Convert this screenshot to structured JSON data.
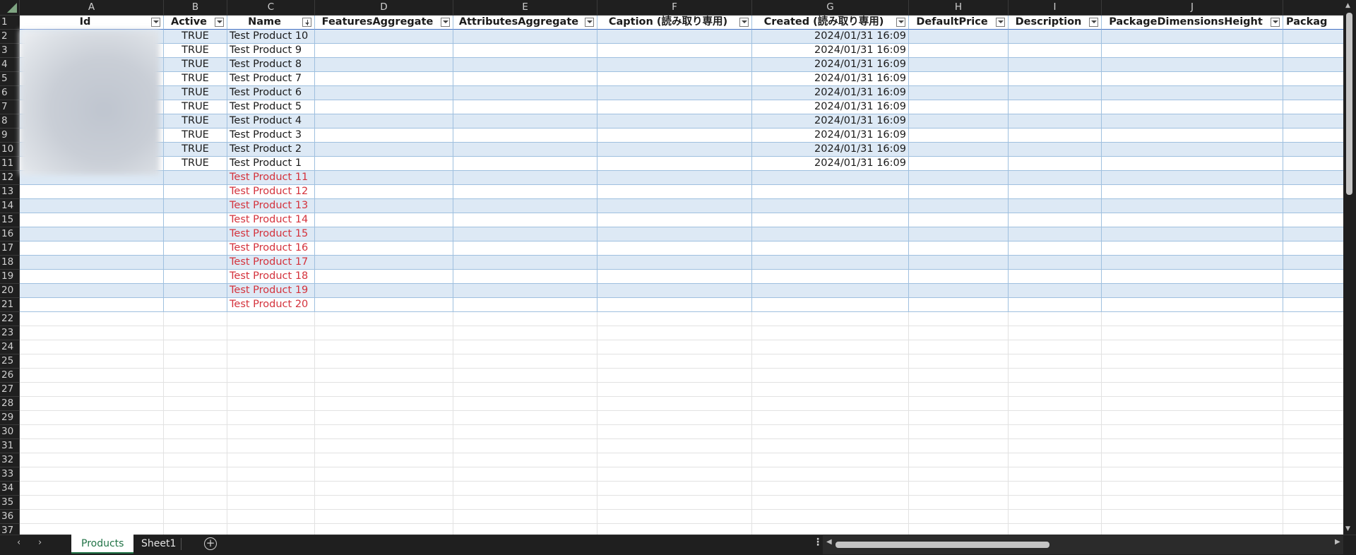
{
  "columns": [
    {
      "letter": "A",
      "header": "Id",
      "width": 204,
      "align": "left"
    },
    {
      "letter": "B",
      "header": "Active",
      "width": 90,
      "align": "center"
    },
    {
      "letter": "C",
      "header": "Name",
      "width": 124,
      "align": "left",
      "sorted": true
    },
    {
      "letter": "D",
      "header": "FeaturesAggregate",
      "width": 196,
      "align": "left"
    },
    {
      "letter": "E",
      "header": "AttributesAggregate",
      "width": 204,
      "align": "left"
    },
    {
      "letter": "F",
      "header": "Caption (読み取り専用)",
      "width": 219,
      "align": "left"
    },
    {
      "letter": "G",
      "header": "Created (読み取り専用)",
      "width": 222,
      "align": "right"
    },
    {
      "letter": "H",
      "header": "DefaultPrice",
      "width": 141,
      "align": "left"
    },
    {
      "letter": "I",
      "header": "Description",
      "width": 132,
      "align": "left"
    },
    {
      "letter": "J",
      "header": "PackageDimensionsHeight",
      "width": 257,
      "align": "left"
    },
    {
      "letter": "",
      "header": "Packag",
      "width": 100,
      "align": "left"
    }
  ],
  "rows": [
    {
      "active": "TRUE",
      "name": "Test Product 10",
      "created": "2024/01/31 16:09",
      "new": false
    },
    {
      "active": "TRUE",
      "name": "Test Product 9",
      "created": "2024/01/31 16:09",
      "new": false
    },
    {
      "active": "TRUE",
      "name": "Test Product 8",
      "created": "2024/01/31 16:09",
      "new": false
    },
    {
      "active": "TRUE",
      "name": "Test Product 7",
      "created": "2024/01/31 16:09",
      "new": false
    },
    {
      "active": "TRUE",
      "name": "Test Product 6",
      "created": "2024/01/31 16:09",
      "new": false
    },
    {
      "active": "TRUE",
      "name": "Test Product 5",
      "created": "2024/01/31 16:09",
      "new": false
    },
    {
      "active": "TRUE",
      "name": "Test Product 4",
      "created": "2024/01/31 16:09",
      "new": false
    },
    {
      "active": "TRUE",
      "name": "Test Product 3",
      "created": "2024/01/31 16:09",
      "new": false
    },
    {
      "active": "TRUE",
      "name": "Test Product 2",
      "created": "2024/01/31 16:09",
      "new": false
    },
    {
      "active": "TRUE",
      "name": "Test Product 1",
      "created": "2024/01/31 16:09",
      "new": false
    },
    {
      "active": "",
      "name": "Test Product 11",
      "created": "",
      "new": true
    },
    {
      "active": "",
      "name": "Test Product 12",
      "created": "",
      "new": true
    },
    {
      "active": "",
      "name": "Test Product 13",
      "created": "",
      "new": true
    },
    {
      "active": "",
      "name": "Test Product 14",
      "created": "",
      "new": true
    },
    {
      "active": "",
      "name": "Test Product 15",
      "created": "",
      "new": true
    },
    {
      "active": "",
      "name": "Test Product 16",
      "created": "",
      "new": true
    },
    {
      "active": "",
      "name": "Test Product 17",
      "created": "",
      "new": true
    },
    {
      "active": "",
      "name": "Test Product 18",
      "created": "",
      "new": true
    },
    {
      "active": "",
      "name": "Test Product 19",
      "created": "",
      "new": true
    },
    {
      "active": "",
      "name": "Test Product 20",
      "created": "",
      "new": true
    }
  ],
  "row_numbers": [
    "1",
    "2",
    "3",
    "4",
    "5",
    "6",
    "7",
    "8",
    "9",
    "10",
    "11",
    "12",
    "13",
    "14",
    "15",
    "16",
    "17",
    "18",
    "19",
    "20",
    "21",
    "22",
    "23",
    "24",
    "25",
    "26",
    "27",
    "28",
    "29",
    "30",
    "31",
    "32",
    "33",
    "34",
    "35",
    "36",
    "37"
  ],
  "sheets": {
    "tabs": [
      "Products",
      "Sheet1"
    ],
    "active": "Products"
  },
  "colors": {
    "header_band": "#dde9f5",
    "new_row_text": "#d4323c",
    "active_tab": "#217346"
  },
  "icons": {
    "filter": "filter-dropdown-icon",
    "sort": "sort-descending-icon",
    "add_sheet": "plus-circle-icon",
    "options": "vertical-dots-icon"
  }
}
